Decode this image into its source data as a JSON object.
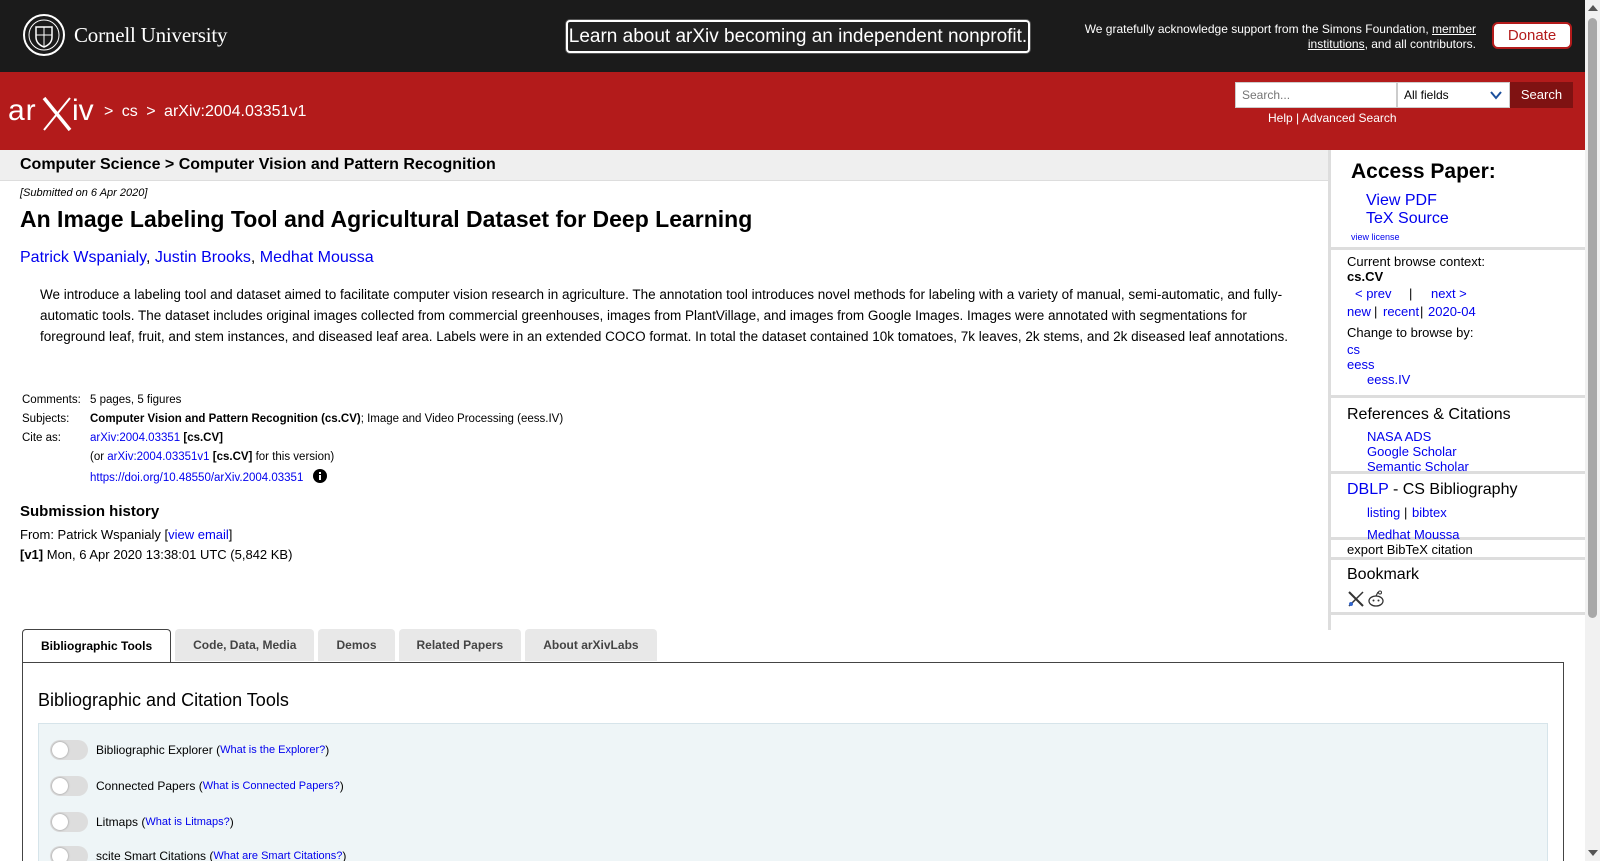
{
  "topbar": {
    "institution": "Cornell University",
    "announcement": "Learn about arXiv becoming an independent nonprofit.",
    "support_prefix": "We gratefully acknowledge support from the Simons Foundation, ",
    "support_link": "member institutions",
    "support_suffix": ", and all contributors.",
    "donate_label": "Donate"
  },
  "header": {
    "logo_text": "arXiv",
    "breadcrumb": [
      ">",
      "cs",
      ">",
      "arXiv:2004.03351v1"
    ],
    "search_placeholder": "Search...",
    "search_field": "All fields",
    "search_button": "Search",
    "help_link": "Help",
    "separator": "|",
    "advanced_link": "Advanced Search"
  },
  "paper": {
    "subheader": "Computer Science > Computer Vision and Pattern Recognition",
    "submitted": "[Submitted on 6 Apr 2020]",
    "title": "An Image Labeling Tool and Agricultural Dataset for Deep Learning",
    "authors": [
      "Patrick Wspanialy",
      "Justin Brooks",
      "Medhat Moussa"
    ],
    "author_sep": ", ",
    "abstract": "We introduce a labeling tool and dataset aimed to facilitate computer vision research in agriculture. The annotation tool introduces novel methods for labeling with a variety of manual, semi-automatic, and fully-automatic tools. The dataset includes original images collected from commercial greenhouses, images from PlantVillage, and images from Google Images. Images were annotated with segmentations for foreground leaf, fruit, and stem instances, and diseased leaf area. Labels were in an extended COCO format. In total the dataset contained 10k tomatoes, 7k leaves, 2k stems, and 2k diseased leaf annotations.",
    "comments_label": "Comments:",
    "comments": "5 pages, 5 figures",
    "subjects_label": "Subjects:",
    "subjects_primary": "Computer Vision and Pattern Recognition (cs.CV)",
    "subjects_rest": "; Image and Video Processing (eess.IV)",
    "cite_label": "Cite as:",
    "cite_id": "arXiv:2004.03351",
    "cite_tag": "[cs.CV]",
    "cite_or": "(or ",
    "cite_version": "arXiv:2004.03351v1",
    "cite_version_tag": "[cs.CV]",
    "cite_version_suffix": " for this version)",
    "doi": "https://doi.org/10.48550/arXiv.2004.03351",
    "history_title": "Submission history",
    "from_prefix": "From: Patrick Wspanialy [",
    "view_email": "view email",
    "from_suffix": "]",
    "v1_tag": "[v1]",
    "v1_text": " Mon, 6 Apr 2020 13:38:01 UTC (5,842 KB)"
  },
  "tabs": [
    "Bibliographic Tools",
    "Code, Data, Media",
    "Demos",
    "Related Papers",
    "About arXivLabs"
  ],
  "tools": {
    "title": "Bibliographic and Citation Tools",
    "rows": [
      {
        "label": "Bibliographic Explorer",
        "link": "What is the Explorer?"
      },
      {
        "label": "Connected Papers",
        "link": "What is Connected Papers?"
      },
      {
        "label": "Litmaps",
        "link": "What is Litmaps?"
      },
      {
        "label": "scite Smart Citations",
        "link": "What are Smart Citations?"
      }
    ]
  },
  "sidebar": {
    "access_title": "Access Paper:",
    "view_pdf": "View PDF",
    "tex_source": "TeX Source",
    "view_license": "view license",
    "browse_context_label": "Current browse context:",
    "browse_context": "cs.CV",
    "prev": "< prev",
    "pipe": "|",
    "next": "next >",
    "new": "new",
    "recent": "recent",
    "month": "2020-04",
    "change_browse_label": "Change to browse by:",
    "browse_cs": "cs",
    "browse_eess": "eess",
    "browse_eess_iv": "eess.IV",
    "refs_title": "References & Citations",
    "nasa_ads": "NASA ADS",
    "google_scholar": "Google Scholar",
    "semantic_scholar": "Semantic Scholar",
    "dblp": "DBLP",
    "dblp_suffix": " - CS Bibliography",
    "listing": "listing",
    "bibtex": "bibtex",
    "dblp_author": "Medhat Moussa",
    "export_bibtex": "export BibTeX citation",
    "bookmark_title": "Bookmark"
  }
}
